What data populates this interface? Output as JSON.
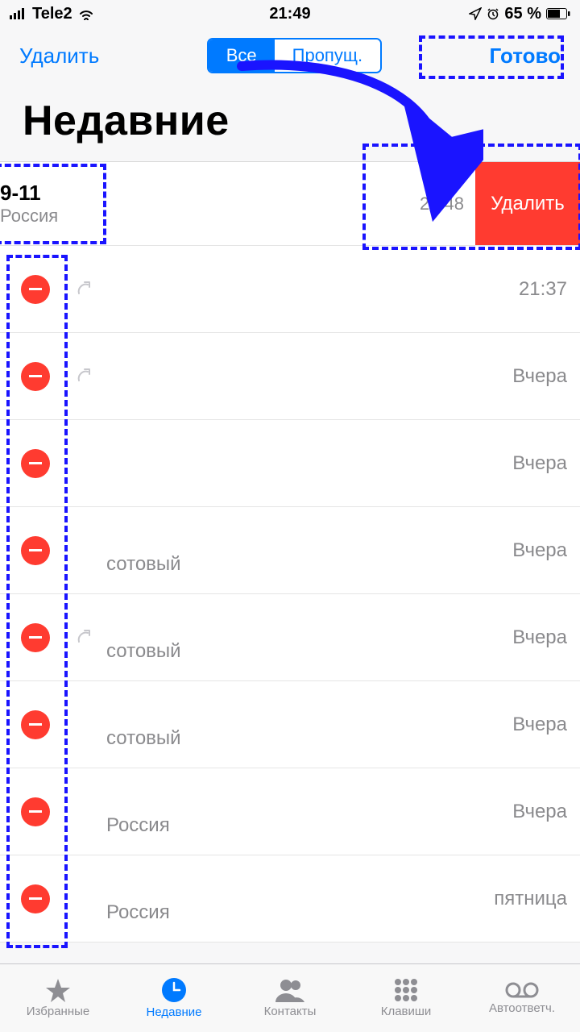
{
  "status": {
    "carrier": "Tele2",
    "time": "21:49",
    "battery": "65 %"
  },
  "nav": {
    "left": "Удалить",
    "seg_all": "Все",
    "seg_missed": "Пропущ.",
    "right": "Готово"
  },
  "title": "Недавние",
  "swiped_row": {
    "name": "9-11",
    "sub": "Россия",
    "time": "21:48",
    "delete": "Удалить"
  },
  "rows": [
    {
      "sub": "",
      "time": "21:37",
      "outgoing": true
    },
    {
      "sub": "",
      "time": "Вчера",
      "outgoing": true
    },
    {
      "sub": "",
      "time": "Вчера",
      "outgoing": false
    },
    {
      "sub": "сотовый",
      "time": "Вчера",
      "outgoing": false
    },
    {
      "sub": "сотовый",
      "time": "Вчера",
      "outgoing": true
    },
    {
      "sub": "сотовый",
      "time": "Вчера",
      "outgoing": false
    },
    {
      "sub": "Россия",
      "time": "Вчера",
      "outgoing": false
    },
    {
      "sub": "Россия",
      "time": "пятница",
      "outgoing": false
    }
  ],
  "tabs": {
    "favorites": "Избранные",
    "recents": "Недавние",
    "contacts": "Контакты",
    "keypad": "Клавиши",
    "voicemail": "Автоответч."
  }
}
